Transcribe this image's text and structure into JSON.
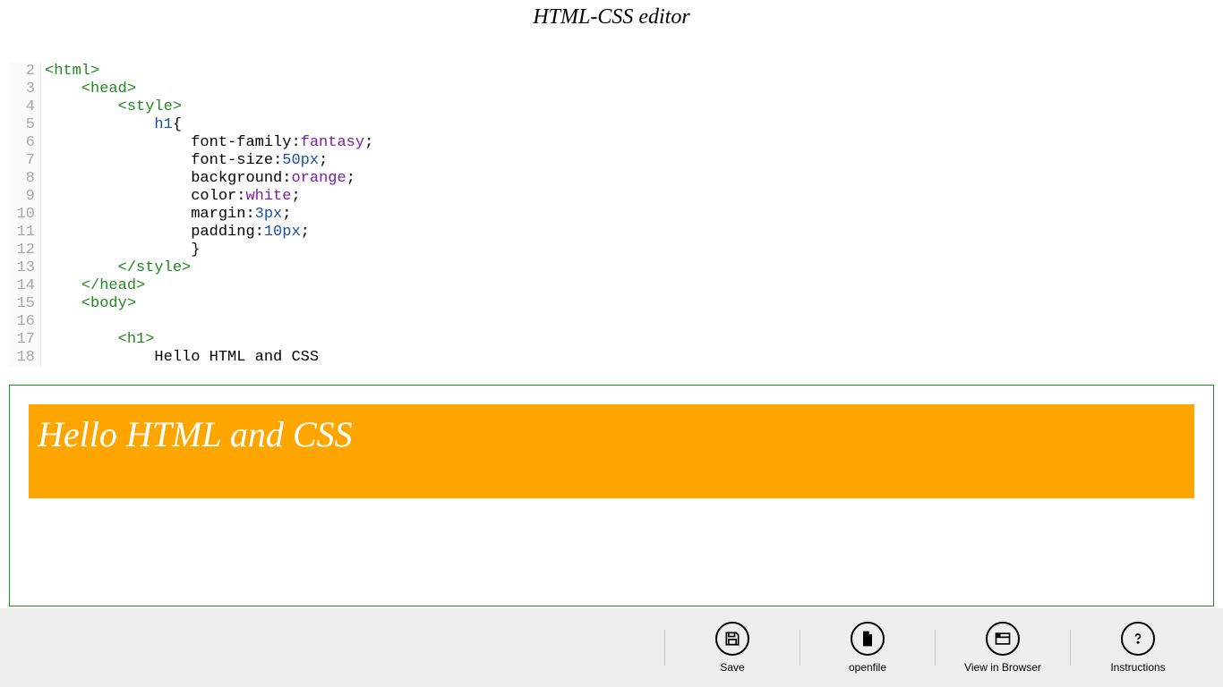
{
  "header": {
    "title": "HTML-CSS editor"
  },
  "editor": {
    "line_start": 2,
    "lines": [
      {
        "n": 2,
        "segs": [
          [
            "tag",
            "<html>"
          ]
        ]
      },
      {
        "n": 3,
        "segs": [
          [
            "txt",
            "    "
          ],
          [
            "tag",
            "<head>"
          ]
        ]
      },
      {
        "n": 4,
        "segs": [
          [
            "txt",
            "        "
          ],
          [
            "tag",
            "<style>"
          ]
        ]
      },
      {
        "n": 5,
        "segs": [
          [
            "txt",
            "            "
          ],
          [
            "sel",
            "h1"
          ],
          [
            "txt",
            "{"
          ]
        ]
      },
      {
        "n": 6,
        "segs": [
          [
            "txt",
            "                "
          ],
          [
            "prop",
            "font-family"
          ],
          [
            "txt",
            ":"
          ],
          [
            "val",
            "fantasy"
          ],
          [
            "txt",
            ";"
          ]
        ]
      },
      {
        "n": 7,
        "segs": [
          [
            "txt",
            "                "
          ],
          [
            "prop",
            "font-size"
          ],
          [
            "txt",
            ":"
          ],
          [
            "num",
            "50px"
          ],
          [
            "txt",
            ";"
          ]
        ]
      },
      {
        "n": 8,
        "segs": [
          [
            "txt",
            "                "
          ],
          [
            "prop",
            "background"
          ],
          [
            "txt",
            ":"
          ],
          [
            "val",
            "orange"
          ],
          [
            "txt",
            ";"
          ]
        ]
      },
      {
        "n": 9,
        "segs": [
          [
            "txt",
            "                "
          ],
          [
            "prop",
            "color"
          ],
          [
            "txt",
            ":"
          ],
          [
            "val",
            "white"
          ],
          [
            "txt",
            ";"
          ]
        ]
      },
      {
        "n": 10,
        "segs": [
          [
            "txt",
            "                "
          ],
          [
            "prop",
            "margin"
          ],
          [
            "txt",
            ":"
          ],
          [
            "num",
            "3px"
          ],
          [
            "txt",
            ";"
          ]
        ]
      },
      {
        "n": 11,
        "segs": [
          [
            "txt",
            "                "
          ],
          [
            "prop",
            "padding"
          ],
          [
            "txt",
            ":"
          ],
          [
            "num",
            "10px"
          ],
          [
            "txt",
            ";"
          ]
        ]
      },
      {
        "n": 12,
        "segs": [
          [
            "txt",
            "                }"
          ]
        ]
      },
      {
        "n": 13,
        "segs": [
          [
            "txt",
            "        "
          ],
          [
            "tag",
            "</style>"
          ]
        ]
      },
      {
        "n": 14,
        "segs": [
          [
            "txt",
            "    "
          ],
          [
            "tag",
            "</head>"
          ]
        ]
      },
      {
        "n": 15,
        "segs": [
          [
            "txt",
            "    "
          ],
          [
            "tag",
            "<body>"
          ]
        ]
      },
      {
        "n": 16,
        "segs": [
          [
            "txt",
            " "
          ]
        ]
      },
      {
        "n": 17,
        "segs": [
          [
            "txt",
            "        "
          ],
          [
            "tag",
            "<h1>"
          ]
        ]
      },
      {
        "n": 18,
        "segs": [
          [
            "txt",
            "            Hello HTML and CSS"
          ]
        ]
      }
    ]
  },
  "preview": {
    "h1_text": "Hello HTML and CSS"
  },
  "appbar": {
    "save": {
      "label": "Save"
    },
    "openfile": {
      "label": "openfile"
    },
    "viewbrowser": {
      "label": "View in Browser"
    },
    "instructions": {
      "label": "Instructions"
    }
  }
}
